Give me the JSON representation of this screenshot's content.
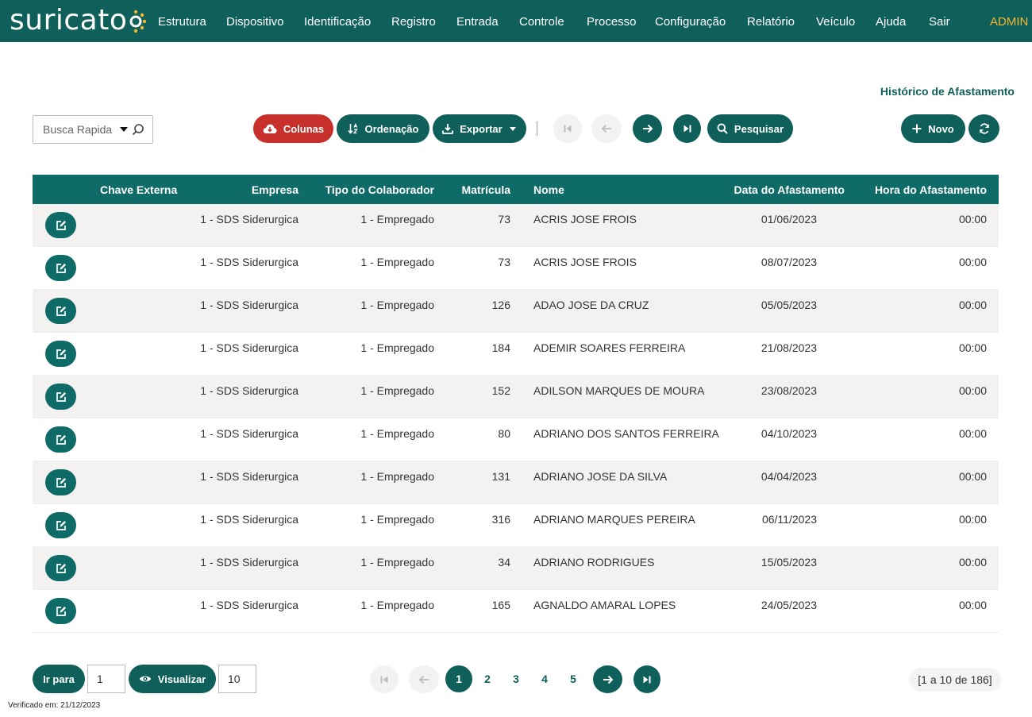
{
  "brand": {
    "name": "suricato",
    "dot_color": "#f3b62d",
    "nav_color": "#0f5f5b"
  },
  "nav": {
    "items": [
      "Estrutura",
      "Dispositivo",
      "Identificação",
      "Registro",
      "Entrada",
      "Controle",
      "Processo",
      "Configuração",
      "Relatório",
      "Veículo",
      "Ajuda",
      "Sair"
    ],
    "user": "ADMIN"
  },
  "page_title": "Histórico de Afastamento",
  "toolbar": {
    "quick_search_placeholder": "Busca Rapida",
    "colunas": "Colunas",
    "ordenacao": "Ordenação",
    "exportar": "Exportar",
    "pesquisar": "Pesquisar",
    "novo": "Novo",
    "icons": [
      "cloud-download-icon",
      "sort-icon",
      "download-icon",
      "first-page-icon",
      "arrow-left-icon",
      "arrow-right-icon",
      "last-page-icon",
      "search-icon",
      "plus-icon",
      "refresh-icon"
    ]
  },
  "table": {
    "headers": [
      "Chave Externa",
      "Empresa",
      "Tipo do Colaborador",
      "Matrícula",
      "Nome",
      "Data do Afastamento",
      "Hora do Afastamento"
    ],
    "rows": [
      {
        "chave": "",
        "empresa": "1 - SDS Siderurgica",
        "tipo": "1 - Empregado",
        "matricula": "73",
        "nome": "ACRIS JOSE FROIS",
        "data": "01/06/2023",
        "hora": "00:00"
      },
      {
        "chave": "",
        "empresa": "1 - SDS Siderurgica",
        "tipo": "1 - Empregado",
        "matricula": "73",
        "nome": "ACRIS JOSE FROIS",
        "data": "08/07/2023",
        "hora": "00:00"
      },
      {
        "chave": "",
        "empresa": "1 - SDS Siderurgica",
        "tipo": "1 - Empregado",
        "matricula": "126",
        "nome": "ADAO JOSE DA CRUZ",
        "data": "05/05/2023",
        "hora": "00:00"
      },
      {
        "chave": "",
        "empresa": "1 - SDS Siderurgica",
        "tipo": "1 - Empregado",
        "matricula": "184",
        "nome": "ADEMIR SOARES FERREIRA",
        "data": "21/08/2023",
        "hora": "00:00"
      },
      {
        "chave": "",
        "empresa": "1 - SDS Siderurgica",
        "tipo": "1 - Empregado",
        "matricula": "152",
        "nome": "ADILSON MARQUES DE MOURA",
        "data": "23/08/2023",
        "hora": "00:00"
      },
      {
        "chave": "",
        "empresa": "1 - SDS Siderurgica",
        "tipo": "1 - Empregado",
        "matricula": "80",
        "nome": "ADRIANO DOS SANTOS FERREIRA",
        "data": "04/10/2023",
        "hora": "00:00"
      },
      {
        "chave": "",
        "empresa": "1 - SDS Siderurgica",
        "tipo": "1 - Empregado",
        "matricula": "131",
        "nome": "ADRIANO JOSE DA SILVA",
        "data": "04/04/2023",
        "hora": "00:00"
      },
      {
        "chave": "",
        "empresa": "1 - SDS Siderurgica",
        "tipo": "1 - Empregado",
        "matricula": "316",
        "nome": "ADRIANO MARQUES PEREIRA",
        "data": "06/11/2023",
        "hora": "00:00"
      },
      {
        "chave": "",
        "empresa": "1 - SDS Siderurgica",
        "tipo": "1 - Empregado",
        "matricula": "34",
        "nome": "ADRIANO RODRIGUES",
        "data": "15/05/2023",
        "hora": "00:00"
      },
      {
        "chave": "",
        "empresa": "1 - SDS Siderurgica",
        "tipo": "1 - Empregado",
        "matricula": "165",
        "nome": "AGNALDO AMARAL LOPES",
        "data": "24/05/2023",
        "hora": "00:00"
      }
    ]
  },
  "footer": {
    "ir_para": "Ir para",
    "ir_para_value": "1",
    "visualizar": "Visualizar",
    "page_size": "10",
    "pages": [
      "1",
      "2",
      "3",
      "4",
      "5"
    ],
    "current_page": "1",
    "range_text": "[1 a 10 de 186]",
    "verified": "Verificado em: 21/12/2023"
  }
}
